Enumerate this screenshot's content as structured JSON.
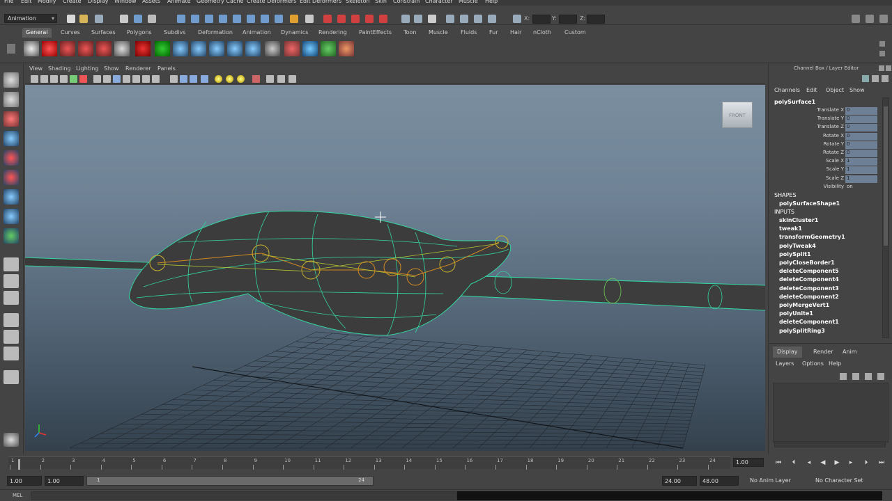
{
  "menubar": [
    "File",
    "Edit",
    "Modify",
    "Create",
    "Display",
    "Window",
    "Assets",
    "Animate",
    "Geometry Cache",
    "Create Deformers",
    "Edit Deformers",
    "Skeleton",
    "Skin",
    "Constrain",
    "Character",
    "Muscle",
    "Help"
  ],
  "status": {
    "mode": "Animation",
    "xyz_labels": [
      "X:",
      "Y:",
      "Z:"
    ]
  },
  "shelf": {
    "tabs": [
      "General",
      "Curves",
      "Surfaces",
      "Polygons",
      "Subdivs",
      "Deformation",
      "Animation",
      "Dynamics",
      "Rendering",
      "PaintEffects",
      "Toon",
      "Muscle",
      "Fluids",
      "Fur",
      "Hair",
      "nCloth",
      "Custom"
    ],
    "active_tab": "General"
  },
  "viewport": {
    "menus": [
      "View",
      "Shading",
      "Lighting",
      "Show",
      "Renderer",
      "Panels"
    ],
    "viewcube_label": "FRONT"
  },
  "channel_box": {
    "title": "Channel Box / Layer Editor",
    "menus": [
      "Channels",
      "Edit",
      "Object",
      "Show"
    ],
    "object": "polySurface1",
    "attributes": [
      {
        "name": "Translate X",
        "value": "0"
      },
      {
        "name": "Translate Y",
        "value": "0"
      },
      {
        "name": "Translate Z",
        "value": "0"
      },
      {
        "name": "Rotate X",
        "value": "0"
      },
      {
        "name": "Rotate Y",
        "value": "0"
      },
      {
        "name": "Rotate Z",
        "value": "0"
      },
      {
        "name": "Scale X",
        "value": "1"
      },
      {
        "name": "Scale Y",
        "value": "1"
      },
      {
        "name": "Scale Z",
        "value": "1"
      },
      {
        "name": "Visibility",
        "value": "on"
      }
    ],
    "shapes_header": "SHAPES",
    "shape": "polySurfaceShape1",
    "inputs_header": "INPUTS",
    "inputs": [
      "skinCluster1",
      "tweak1",
      "transformGeometry1",
      "polyTweak4",
      "polySplit1",
      "polyCloseBorder1",
      "deleteComponent5",
      "deleteComponent4",
      "deleteComponent3",
      "deleteComponent2",
      "polyMergeVert1",
      "polyUnite1",
      "deleteComponent1",
      "polySplitRing3"
    ]
  },
  "layer_editor": {
    "tabs": [
      "Display",
      "Render",
      "Anim"
    ],
    "active_tab": "Display",
    "menus": [
      "Layers",
      "Options",
      "Help"
    ]
  },
  "timeline": {
    "ticks": [
      "1",
      "2",
      "3",
      "4",
      "5",
      "6",
      "7",
      "8",
      "9",
      "10",
      "11",
      "12",
      "13",
      "14",
      "15",
      "16",
      "17",
      "18",
      "19",
      "20",
      "21",
      "22",
      "23",
      "24"
    ],
    "current_time": "1.00",
    "range_start": "1.00",
    "playback_start": "1.00",
    "range_bar_start": "1",
    "range_bar_end": "24",
    "playback_end": "24.00",
    "range_end": "48.00",
    "anim_layer": "No Anim Layer",
    "character_set": "No Character Set"
  },
  "command_line": {
    "label": "MEL"
  }
}
